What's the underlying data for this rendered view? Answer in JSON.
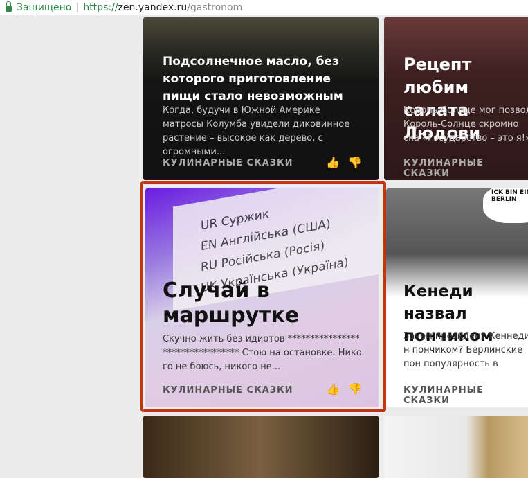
{
  "browser": {
    "secure_label": "Защищено",
    "url_scheme": "https://",
    "url_host": "zen.yandex.ru",
    "url_path": "/gastronom"
  },
  "cards": [
    {
      "title": "Подсолнечное масло, без которого приготовление пищи стало невозможным",
      "desc": "Когда, будучи в Южной Америке матросы Колумба увидели диковинное растение – высокое как дерево, с огромными...",
      "source": "КУЛИНАРНЫЕ СКАЗКИ"
    },
    {
      "title": "Рецепт любим салата Людови",
      "desc": "Король-Солнце мог позвол Король-Солнце скромно ска «Государство – это я!» был",
      "source": "КУЛИНАРНЫЕ СКАЗКИ"
    },
    {
      "title": "Случай в маршрутке",
      "desc": "Скучно жить без идиотов ********************************* Стою на остановке. Никого не боюсь, никого не...",
      "source": "КУЛИНАРНЫЕ СКАЗКИ",
      "image_text": [
        "UR Суржик",
        "EN Англійська (США)",
        "RU Російська (Росія)",
        "UK Українська (Україна)"
      ]
    },
    {
      "title": "Кенеди назвал пончиком",
      "desc": "Зачем президент Кеннеди н пончиком? Берлинские пон популярность в Германских",
      "source": "КУЛИНАРНЫЕ СКАЗКИ",
      "image_text": "ICK BIN EIN BERLIN"
    }
  ]
}
